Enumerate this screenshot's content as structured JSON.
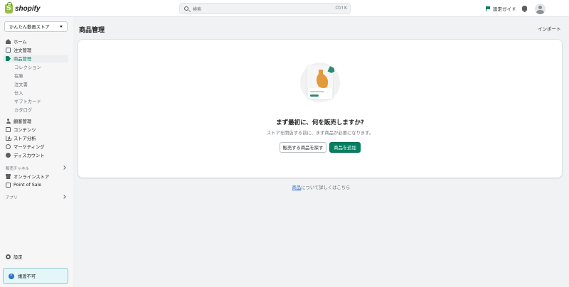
{
  "topbar": {
    "logo_text": "shopify",
    "search_placeholder": "検索",
    "search_shortcut": "Ctrl K",
    "setup_guide_label": "設定ガイド"
  },
  "sidebar": {
    "store_name": "かんたん動画ストア",
    "items": [
      {
        "label": "ホーム",
        "icon": "home-icon"
      },
      {
        "label": "注文管理",
        "icon": "orders-icon"
      },
      {
        "label": "商品管理",
        "icon": "tag-icon",
        "active": true
      }
    ],
    "product_sub_items": [
      "コレクション",
      "在庫",
      "注文書",
      "仕入",
      "ギフトカード",
      "カタログ"
    ],
    "items2": [
      {
        "label": "顧客管理",
        "icon": "person-icon"
      },
      {
        "label": "コンテンツ",
        "icon": "content-icon"
      },
      {
        "label": "ストア分析",
        "icon": "analytics-icon"
      },
      {
        "label": "マーケティング",
        "icon": "marketing-icon"
      },
      {
        "label": "ディスカウント",
        "icon": "discount-icon"
      }
    ],
    "sales_channels_heading": "販売チャネル",
    "channels": [
      {
        "label": "オンラインストア",
        "icon": "store-icon"
      },
      {
        "label": "Point of Sale",
        "icon": "pos-icon"
      }
    ],
    "apps_heading": "アプリ",
    "settings_label": "設定",
    "banner_text": "譲渡不可"
  },
  "main": {
    "page_title": "商品管理",
    "import_label": "インポート",
    "empty_title": "まず最初に、何を販売しますか?",
    "empty_description": "ストアを開店する前に、まず商品が必要になります。",
    "find_products_button": "販売する商品を探す",
    "add_product_button": "商品を追加",
    "learn_link": "商品",
    "learn_suffix": "について詳しくはこちら"
  },
  "colors": {
    "accent": "#008060",
    "active_nav": "#007f5f",
    "link": "#2c6ecb",
    "background": "#f1f2f4"
  }
}
